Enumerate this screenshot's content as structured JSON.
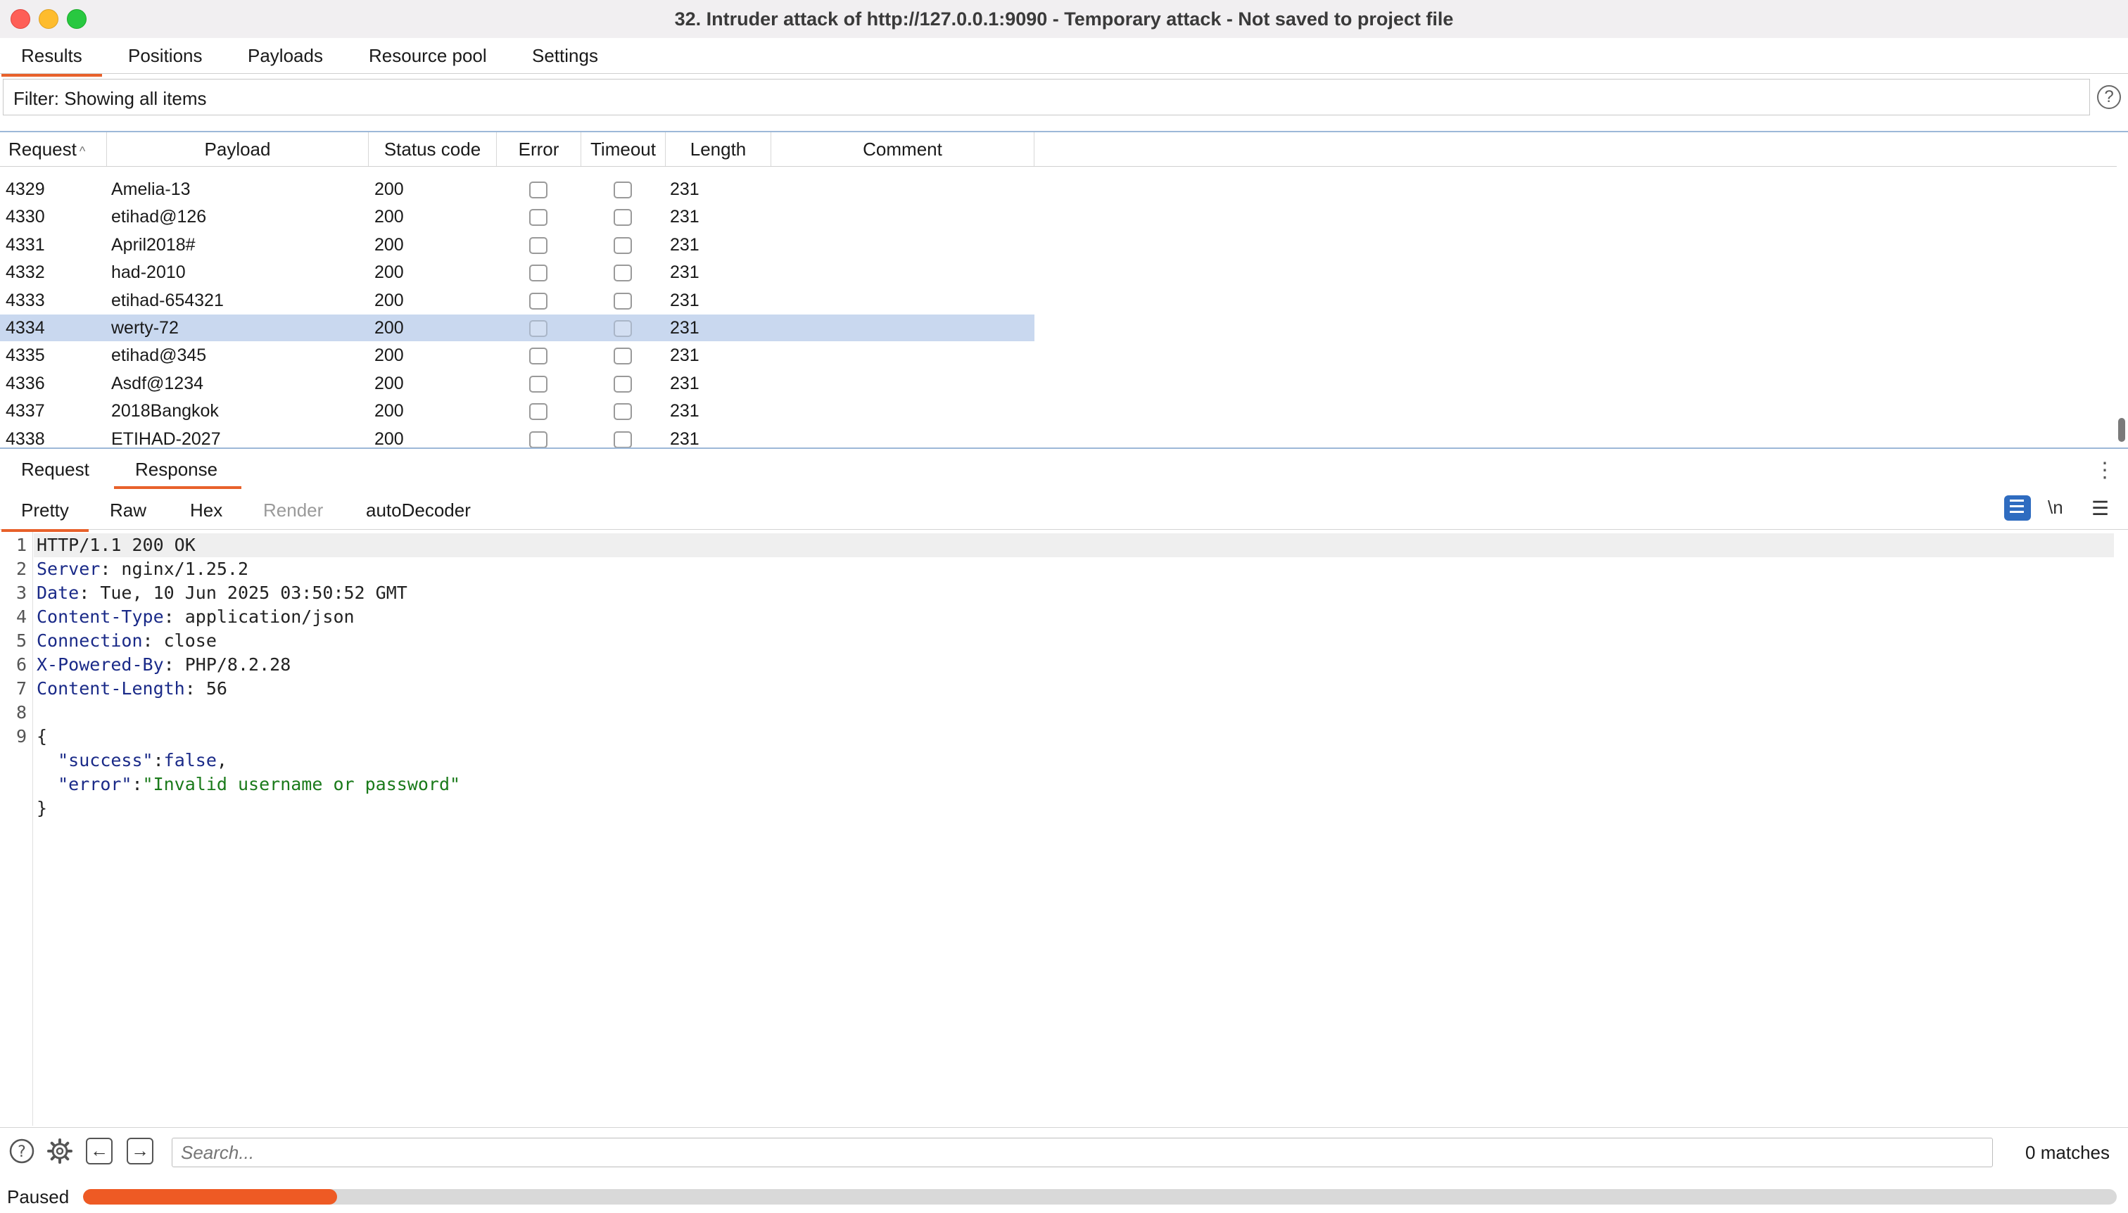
{
  "window": {
    "title": "32. Intruder attack of http://127.0.0.1:9090 - Temporary attack - Not saved to project file"
  },
  "main_tabs": [
    "Results",
    "Positions",
    "Payloads",
    "Resource pool",
    "Settings"
  ],
  "filter": {
    "text": "Filter: Showing all items"
  },
  "table": {
    "columns": [
      "Request",
      "Payload",
      "Status code",
      "Error",
      "Timeout",
      "Length",
      "Comment"
    ],
    "rows": [
      {
        "request": "4329",
        "payload": "Amelia-13",
        "status": "200",
        "length": "231"
      },
      {
        "request": "4330",
        "payload": "etihad@126",
        "status": "200",
        "length": "231"
      },
      {
        "request": "4331",
        "payload": "April2018#",
        "status": "200",
        "length": "231"
      },
      {
        "request": "4332",
        "payload": "had-2010",
        "status": "200",
        "length": "231"
      },
      {
        "request": "4333",
        "payload": "etihad-654321",
        "status": "200",
        "length": "231"
      },
      {
        "request": "4334",
        "payload": "werty-72",
        "status": "200",
        "length": "231",
        "selected": true
      },
      {
        "request": "4335",
        "payload": "etihad@345",
        "status": "200",
        "length": "231"
      },
      {
        "request": "4336",
        "payload": "Asdf@1234",
        "status": "200",
        "length": "231"
      },
      {
        "request": "4337",
        "payload": "2018Bangkok",
        "status": "200",
        "length": "231"
      },
      {
        "request": "4338",
        "payload": "ETIHAD-2027",
        "status": "200",
        "length": "231"
      }
    ]
  },
  "rr_tabs": [
    "Request",
    "Response"
  ],
  "editor_tabs": [
    "Pretty",
    "Raw",
    "Hex",
    "Render",
    "autoDecoder"
  ],
  "editor_tools": {
    "newline_label": "\\n"
  },
  "response_lines": [
    {
      "n": "1",
      "parts": [
        [
          "v",
          "HTTP/1.1 200 OK"
        ]
      ]
    },
    {
      "n": "2",
      "parts": [
        [
          "k",
          "Server"
        ],
        [
          "v",
          ": nginx/1.25.2"
        ]
      ]
    },
    {
      "n": "3",
      "parts": [
        [
          "k",
          "Date"
        ],
        [
          "v",
          ": Tue, 10 Jun 2025 03:50:52 GMT"
        ]
      ]
    },
    {
      "n": "4",
      "parts": [
        [
          "k",
          "Content-Type"
        ],
        [
          "v",
          ": application/json"
        ]
      ]
    },
    {
      "n": "5",
      "parts": [
        [
          "k",
          "Connection"
        ],
        [
          "v",
          ": close"
        ]
      ]
    },
    {
      "n": "6",
      "parts": [
        [
          "k",
          "X-Powered-By"
        ],
        [
          "v",
          ": PHP/8.2.28"
        ]
      ]
    },
    {
      "n": "7",
      "parts": [
        [
          "k",
          "Content-Length"
        ],
        [
          "v",
          ": 56"
        ]
      ]
    },
    {
      "n": "8",
      "parts": []
    },
    {
      "n": "9",
      "parts": [
        [
          "v",
          "{"
        ]
      ]
    },
    {
      "n": "",
      "parts": [
        [
          "v",
          "  "
        ],
        [
          "k",
          "\"success\""
        ],
        [
          "v",
          ":"
        ],
        [
          "k",
          "false"
        ],
        [
          "v",
          ","
        ]
      ]
    },
    {
      "n": "",
      "parts": [
        [
          "v",
          "  "
        ],
        [
          "k",
          "\"error\""
        ],
        [
          "v",
          ":"
        ],
        [
          "s",
          "\"Invalid username or password\""
        ]
      ]
    },
    {
      "n": "",
      "parts": [
        [
          "v",
          "}"
        ]
      ]
    }
  ],
  "search": {
    "placeholder": "Search...",
    "matches": "0 matches"
  },
  "status": {
    "text": "Paused",
    "progress": 0.125
  },
  "colors": {
    "accent": "#e8612b",
    "selected_row": "#c9d8ef",
    "progress": "#ee5a24"
  }
}
